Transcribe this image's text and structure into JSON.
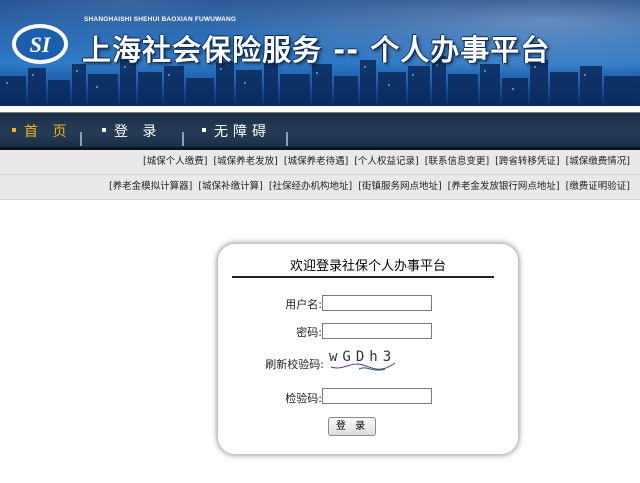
{
  "header": {
    "pinyin": "SHANGHAISHI SHEHUI BAOXIAN FUWUWANG",
    "title": "上海社会保险服务 -- 个人办事平台",
    "logo_text": "SI"
  },
  "nav": {
    "items": [
      {
        "label": "首 页",
        "active": true
      },
      {
        "label": "登 录",
        "active": false
      },
      {
        "label": "无障碍",
        "active": false
      }
    ]
  },
  "links_row1": [
    "[城保个人缴费]",
    "[城保养老发放]",
    "[城保养老待遇]",
    "[个人权益记录]",
    "[联系信息变更]",
    "[跨省转移凭证]",
    "[城保缴费情况]"
  ],
  "links_row2": [
    "[养老金模拟计算器]",
    "[城保补缴计算]",
    "[社保经办机构地址]",
    "[街镇服务网点地址]",
    "[养老金发放银行网点地址]",
    "[缴费证明验证]"
  ],
  "login": {
    "heading": "欢迎登录社保个人办事平台",
    "username_label": "用户名:",
    "password_label": "密码:",
    "refresh_label": "刷新校验码:",
    "captcha_text": "wGDh3",
    "code_label": "检验码:",
    "submit_label": "登 录",
    "username_value": "",
    "password_value": "",
    "code_value": ""
  },
  "colors": {
    "nav_active": "#f1b21c",
    "nav_bg": "#1b2e44",
    "banner_blue": "#1a5fae",
    "link_bar_bg": "#e9e9e9"
  }
}
